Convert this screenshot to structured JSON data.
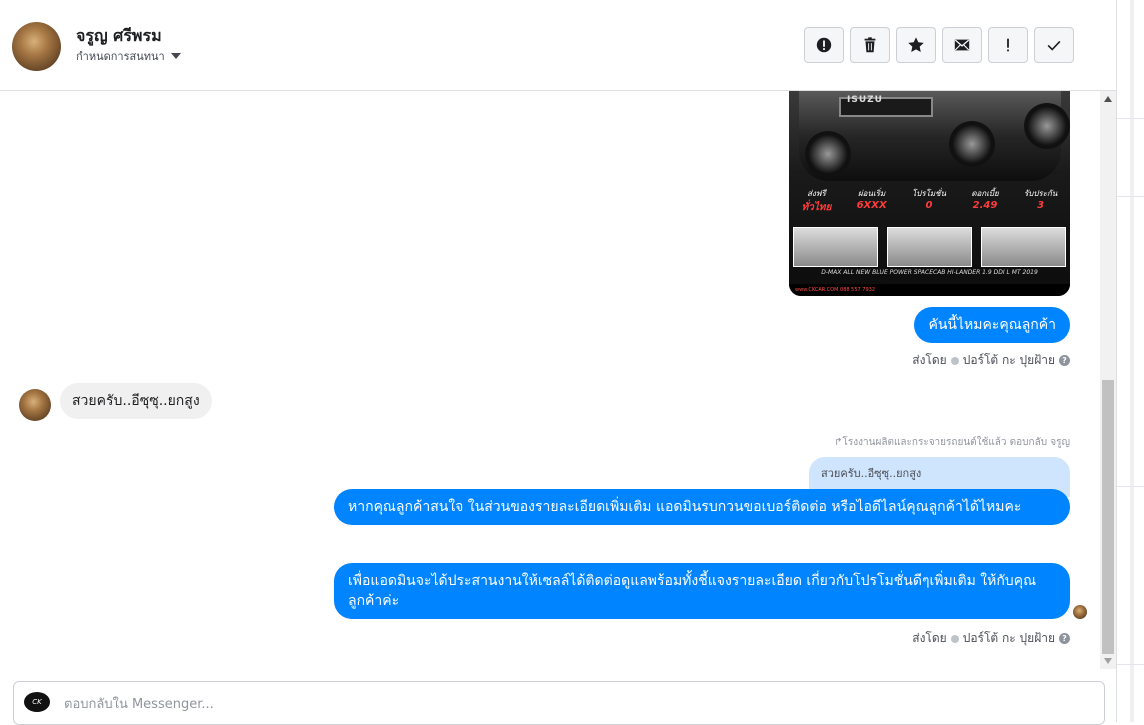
{
  "header": {
    "name": "จรูญ ศรีพรม",
    "subtitle": "กำหนดการสนทนา",
    "actions": [
      {
        "icon": "alert-circle-icon",
        "name": "spam-button"
      },
      {
        "icon": "trash-icon",
        "name": "delete-button"
      },
      {
        "icon": "star-icon",
        "name": "star-button"
      },
      {
        "icon": "envelope-icon",
        "name": "mark-unread-button"
      },
      {
        "icon": "exclamation-icon",
        "name": "follow-up-button"
      },
      {
        "icon": "check-icon",
        "name": "done-button"
      }
    ]
  },
  "car_ad": {
    "brand": "ISUZU",
    "specs": [
      {
        "label": "ส่งฟรี",
        "value": "ทั่วไทย"
      },
      {
        "label": "ผ่อนเริ่ม",
        "value": "6XXX"
      },
      {
        "label": "โปรโมชั่น",
        "value": "0"
      },
      {
        "label": "ดอกเบี้ย",
        "value": "2.49"
      },
      {
        "label": "รับประกัน",
        "value": "3"
      }
    ],
    "caption": "D-MAX ALL NEW BLUE POWER SPACECAB HI-LANDER 1.9 DDI L MT 2019",
    "footer": "www.CKCAR.COM 088 557 7932"
  },
  "messages": {
    "out1": "คันนี้ไหมคะคุณลูกค้า",
    "sent_by_label": "ส่งโดย",
    "sender": "ปอร์โต้ กะ ปุยฝ้าย",
    "in1": "สวยครับ..อีซุซุ..ยกสูง",
    "reply_meta": "โรงงานผลิตและกระจายรถยนต์ใช้แล้ว ตอบกลับ จรูญ",
    "quote": "สวยครับ..อีซุซุ..ยกสูง",
    "out2": "หากคุณลูกค้าสนใจ ในส่วนของรายละเอียดเพิ่มเติม แอดมินรบกวนขอเบอร์ติดต่อ หรือไอดีไลน์คุณลูกค้าได้ไหมคะ",
    "out3": "เพื่อแอดมินจะได้ประสานงานให้เซลล์ได้ติดต่อดูแลพร้อมทั้งชี้แจงรายละเอียด เกี่ยวกับโปรโมชั่นดีๆเพิ่มเติม ให้กับคุณลูกค้าค่ะ"
  },
  "composer": {
    "placeholder": "ตอบกลับใน Messenger..."
  }
}
